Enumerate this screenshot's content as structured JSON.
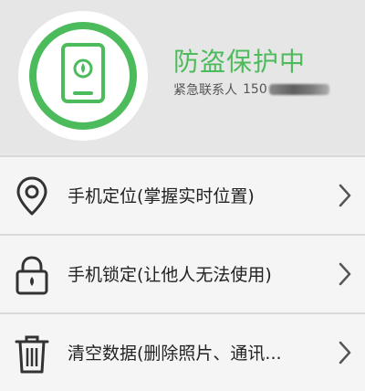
{
  "status": {
    "title": "防盗保护中",
    "contact_label": "紧急联系人",
    "contact_number_visible": "150"
  },
  "colors": {
    "accent": "#4cbb5b",
    "text": "#222222",
    "secondary_text": "#555555",
    "background": "#e9e9e9",
    "item_background": "#f5f5f5"
  },
  "menu": {
    "items": [
      {
        "label": "手机定位(掌握实时位置)",
        "icon": "location-pin-icon"
      },
      {
        "label": "手机锁定(让他人无法使用)",
        "icon": "padlock-icon"
      },
      {
        "label": "清空数据(删除照片、通讯...",
        "icon": "trash-icon"
      }
    ]
  }
}
